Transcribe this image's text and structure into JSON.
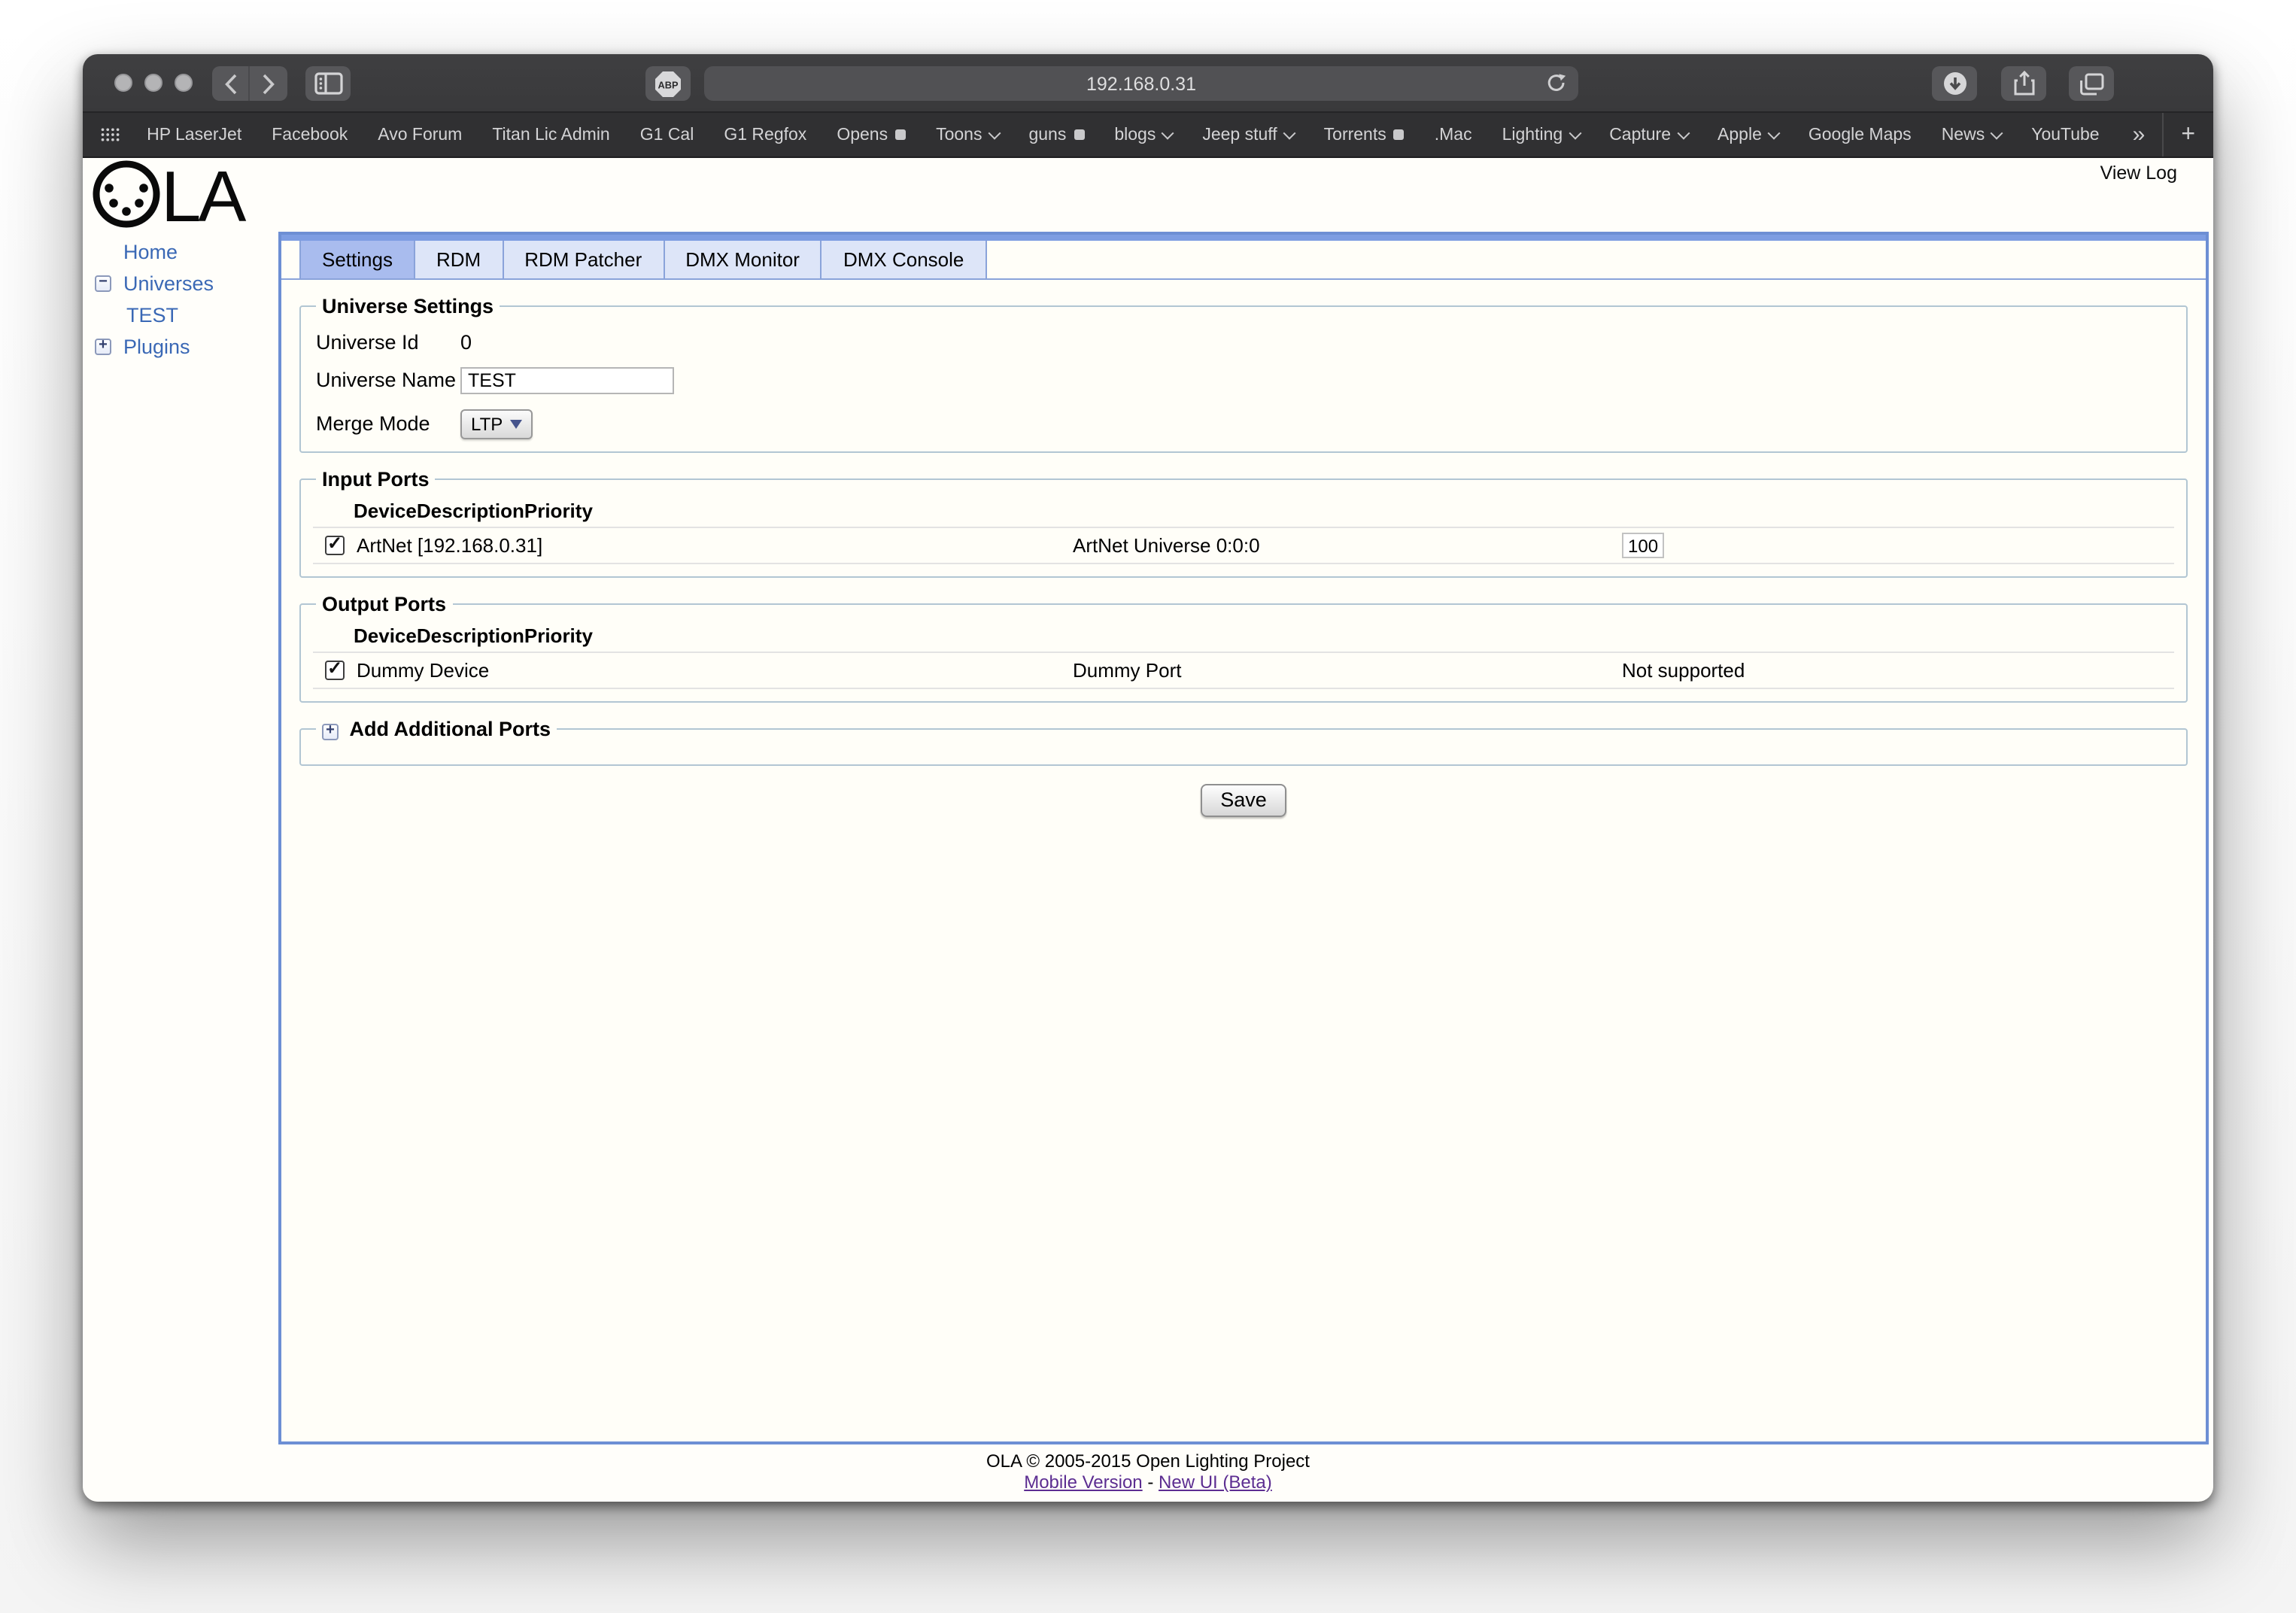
{
  "browser": {
    "url": "192.168.0.31",
    "adblock_badge": "ABP",
    "bookmarks": [
      {
        "label": "HP LaserJet",
        "marker": "none"
      },
      {
        "label": "Facebook",
        "marker": "none"
      },
      {
        "label": "Avo Forum",
        "marker": "none"
      },
      {
        "label": "Titan Lic Admin",
        "marker": "none"
      },
      {
        "label": "G1 Cal",
        "marker": "none"
      },
      {
        "label": "G1 Regfox",
        "marker": "none"
      },
      {
        "label": "Opens",
        "marker": "square"
      },
      {
        "label": "Toons",
        "marker": "chevron"
      },
      {
        "label": "guns",
        "marker": "square"
      },
      {
        "label": "blogs",
        "marker": "chevron"
      },
      {
        "label": "Jeep stuff",
        "marker": "chevron"
      },
      {
        "label": "Torrents",
        "marker": "square"
      },
      {
        "label": ".Mac",
        "marker": "none"
      },
      {
        "label": "Lighting",
        "marker": "chevron"
      },
      {
        "label": "Capture",
        "marker": "chevron"
      },
      {
        "label": "Apple",
        "marker": "chevron"
      },
      {
        "label": "Google Maps",
        "marker": "none"
      },
      {
        "label": "News",
        "marker": "chevron"
      },
      {
        "label": "YouTube",
        "marker": "none"
      }
    ],
    "overflow_label": "»",
    "new_tab_label": "+"
  },
  "page": {
    "view_log": "View Log",
    "logo_text": "LA",
    "sidebar": {
      "home": "Home",
      "universes": "Universes",
      "universes_toggle": "−",
      "test": "TEST",
      "plugins": "Plugins",
      "plugins_toggle": "+"
    },
    "tabs": [
      {
        "label": "Settings",
        "selected": true
      },
      {
        "label": "RDM",
        "selected": false
      },
      {
        "label": "RDM Patcher",
        "selected": false
      },
      {
        "label": "DMX Monitor",
        "selected": false
      },
      {
        "label": "DMX Console",
        "selected": false
      }
    ],
    "universe_settings": {
      "legend": "Universe Settings",
      "id_label": "Universe Id",
      "id_value": "0",
      "name_label": "Universe Name",
      "name_value": "TEST",
      "merge_label": "Merge Mode",
      "merge_value": "LTP"
    },
    "input_ports": {
      "legend": "Input Ports",
      "headers": {
        "device": "Device",
        "description": "Description",
        "priority": "Priority"
      },
      "rows": [
        {
          "checked": true,
          "device": "ArtNet [192.168.0.31]",
          "description": "ArtNet Universe 0:0:0",
          "priority": "100"
        }
      ]
    },
    "output_ports": {
      "legend": "Output Ports",
      "headers": {
        "device": "Device",
        "description": "Description",
        "priority": "Priority"
      },
      "rows": [
        {
          "checked": true,
          "device": "Dummy Device",
          "description": "Dummy Port",
          "priority": "Not supported"
        }
      ]
    },
    "add_ports": {
      "legend": "Add Additional Ports",
      "toggle": "+"
    },
    "save_label": "Save",
    "footer": {
      "copyright": "OLA © 2005-2015 Open Lighting Project",
      "mobile_link": "Mobile Version",
      "separator": "-",
      "new_ui_link": "New UI (Beta)"
    },
    "colors": {
      "selected_tab": "#a9bcee",
      "panel_border": "#6d8fd4",
      "sidebar_link": "#3a68b5",
      "visited_link": "#5c2d91"
    }
  }
}
